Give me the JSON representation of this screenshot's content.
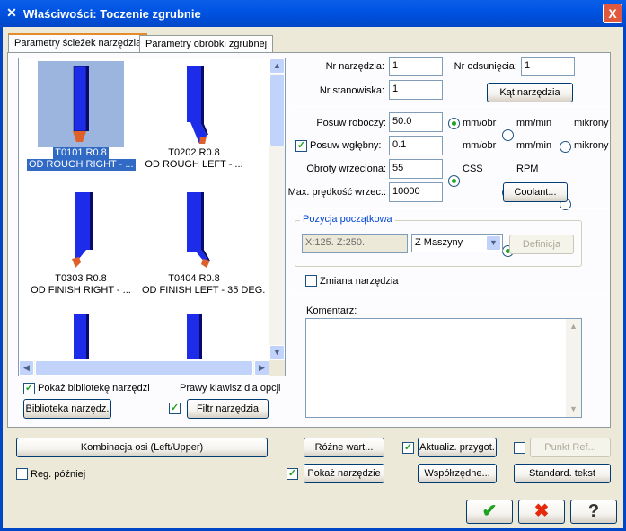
{
  "window": {
    "title": "Właściwości: Toczenie zgrubnie",
    "close_glyph": "X"
  },
  "tabs": [
    {
      "label": "Parametry ścieżek narzędzia"
    },
    {
      "label": "Parametry obróbki zgrubnej"
    }
  ],
  "tools": [
    {
      "code": "T0101 R0.8",
      "name": "OD ROUGH RIGHT - ...",
      "selected": true
    },
    {
      "code": "T0202 R0.8",
      "name": "OD ROUGH LEFT - ...",
      "selected": false
    },
    {
      "code": "T0303 R0.8",
      "name": "OD FINISH RIGHT - ...",
      "selected": false
    },
    {
      "code": "T0404 R0.8",
      "name": "OD FINISH LEFT - 35 DEG.",
      "selected": false
    }
  ],
  "left": {
    "show_library_label": "Pokaż bibliotekę narzędzi",
    "right_click_label": "Prawy klawisz dla opcji",
    "library_button": "Biblioteka narzędz.",
    "filter_button": "Filtr narzędzia"
  },
  "fields": {
    "tool_number_label": "Nr narzędzia:",
    "tool_number": "1",
    "offset_number_label": "Nr odsunięcia:",
    "offset_number": "1",
    "station_label": "Nr stanowiska:",
    "station": "1",
    "tool_angle_button": "Kąt narzędzia",
    "feed_label": "Posuw roboczy:",
    "feed": "50.0",
    "plunge_label": "Posuw wgłębny:",
    "plunge": "0.1",
    "spindle_label": "Obroty wrzeciona:",
    "spindle": "55",
    "max_speed_label": "Max. prędkość wrzec.:",
    "max_speed": "10000",
    "coolant_button": "Coolant..."
  },
  "units": {
    "mm_obr": "mm/obr",
    "mm_min": "mm/min",
    "mikrony": "mikrony",
    "css": "CSS",
    "rpm": "RPM"
  },
  "home": {
    "legend": "Pozycja początkowa",
    "coords": "X:125.  Z:250.",
    "mode": "Z Maszyny",
    "define_button": "Definicja"
  },
  "tool_change_label": "Zmiana narzędzia",
  "comment_label": "Komentarz:",
  "comment": "",
  "bottom": {
    "axis_combo_button": "Kombinacja osi (Left/Upper)",
    "misc_values_button": "Różne wart...",
    "update_stock_button": "Aktualiz. przygot.",
    "ref_point_button": "Punkt Ref...",
    "reg_later_label": "Reg. później",
    "show_tool_button": "Pokaż narzędzie",
    "coordinates_button": "Współrzędne...",
    "canned_text_button": "Standard. tekst"
  },
  "colors": {
    "accent": "#316AC5",
    "titlebar": "#0054E3",
    "tool_body": "#1D2CE8",
    "tool_insert": "#E0602A",
    "ok": "#21A121",
    "cancel": "#E52A0C"
  }
}
